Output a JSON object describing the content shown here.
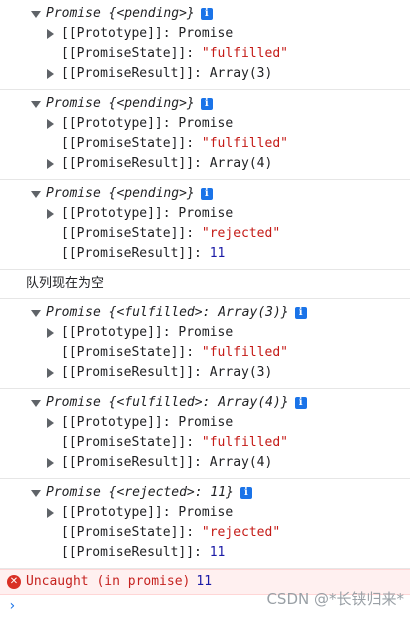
{
  "entries": [
    {
      "title": "Promise",
      "state_text": "{<pending>}",
      "info_icon": "i",
      "prototype": {
        "key": "[[Prototype]]:",
        "value": "Promise"
      },
      "state": {
        "key": "[[PromiseState]]:",
        "value": "\"fulfilled\""
      },
      "result": {
        "key": "[[PromiseResult]]:",
        "value": "Array(3)",
        "kind": "object",
        "expandable": true
      }
    },
    {
      "title": "Promise",
      "state_text": "{<pending>}",
      "info_icon": "i",
      "prototype": {
        "key": "[[Prototype]]:",
        "value": "Promise"
      },
      "state": {
        "key": "[[PromiseState]]:",
        "value": "\"fulfilled\""
      },
      "result": {
        "key": "[[PromiseResult]]:",
        "value": "Array(4)",
        "kind": "object",
        "expandable": true
      }
    },
    {
      "title": "Promise",
      "state_text": "{<pending>}",
      "info_icon": "i",
      "prototype": {
        "key": "[[Prototype]]:",
        "value": "Promise"
      },
      "state": {
        "key": "[[PromiseState]]:",
        "value": "\"rejected\""
      },
      "result": {
        "key": "[[PromiseResult]]:",
        "value": "11",
        "kind": "number",
        "expandable": false
      }
    }
  ],
  "log_message": "队列现在为空",
  "entries_after": [
    {
      "title": "Promise",
      "state_text": "{<fulfilled>: Array(3)}",
      "info_icon": "i",
      "prototype": {
        "key": "[[Prototype]]:",
        "value": "Promise"
      },
      "state": {
        "key": "[[PromiseState]]:",
        "value": "\"fulfilled\""
      },
      "result": {
        "key": "[[PromiseResult]]:",
        "value": "Array(3)",
        "kind": "object",
        "expandable": true
      }
    },
    {
      "title": "Promise",
      "state_text": "{<fulfilled>: Array(4)}",
      "info_icon": "i",
      "prototype": {
        "key": "[[Prototype]]:",
        "value": "Promise"
      },
      "state": {
        "key": "[[PromiseState]]:",
        "value": "\"fulfilled\""
      },
      "result": {
        "key": "[[PromiseResult]]:",
        "value": "Array(4)",
        "kind": "object",
        "expandable": true
      }
    },
    {
      "title": "Promise",
      "state_text": "{<rejected>: 11}",
      "info_icon": "i",
      "prototype": {
        "key": "[[Prototype]]:",
        "value": "Promise"
      },
      "state": {
        "key": "[[PromiseState]]:",
        "value": "\"rejected\""
      },
      "result": {
        "key": "[[PromiseResult]]:",
        "value": "11",
        "kind": "number",
        "expandable": false
      }
    }
  ],
  "error": {
    "icon": "✕",
    "text": "Uncaught (in promise)",
    "value": "11"
  },
  "prompt": {
    "symbol": "›"
  },
  "watermark": "CSDN @*长铗归来*",
  "colors": {
    "string": "#c41a16",
    "number": "#1a1aa6",
    "error_bg": "#fff0f0",
    "info": "#1a73e8"
  }
}
